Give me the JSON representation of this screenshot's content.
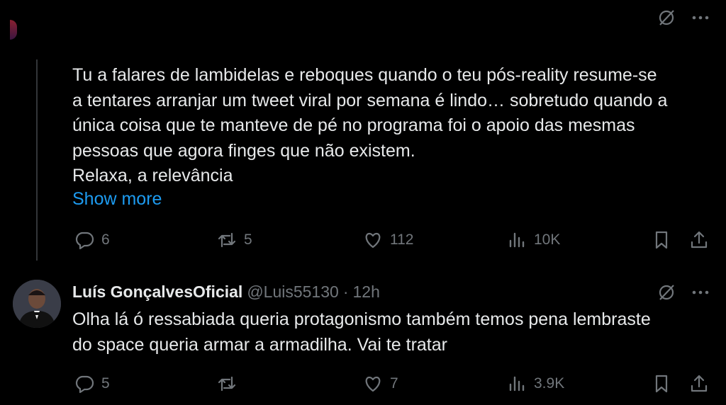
{
  "tweet1": {
    "text_lines": [
      "Tu a falares de lambidelas e reboques quando o teu pós-reality resume-se",
      "a tentares arranjar um tweet viral por semana é lindo… sobretudo quando a",
      "única coisa que te manteve de pé no programa foi o apoio das mesmas",
      "pessoas que agora finges que não existem.",
      "Relaxa, a relevância"
    ],
    "show_more": "Show more",
    "replies": "6",
    "reposts": "5",
    "likes": "112",
    "views": "10K"
  },
  "tweet2": {
    "display_name": "Luís GonçalvesOficial",
    "handle": "@Luis55130",
    "separator": "·",
    "time": "12h",
    "text_lines": [
      "Olha lá ó ressabiada queria protagonismo também temos pena lembraste",
      "do space queria armar a armadilha. Vai te tratar"
    ],
    "replies": "5",
    "reposts": "",
    "likes": "7",
    "views": "3.9K"
  },
  "colors": {
    "background": "#000000",
    "text": "#e7e9ea",
    "muted": "#71767b",
    "link": "#1d9bf0"
  },
  "icons": [
    "grok-icon",
    "more-icon",
    "reply-icon",
    "repost-icon",
    "like-icon",
    "views-icon",
    "bookmark-icon",
    "share-icon"
  ]
}
